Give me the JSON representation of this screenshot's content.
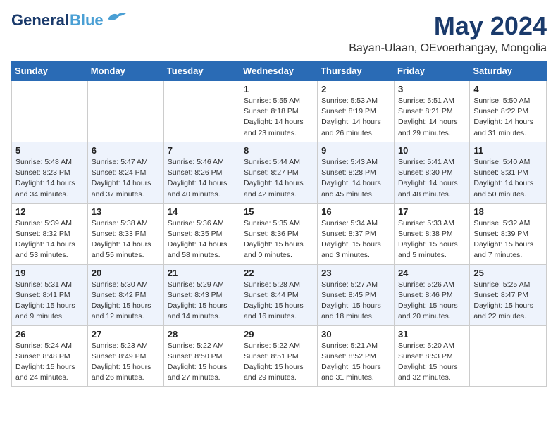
{
  "header": {
    "logo_general": "General",
    "logo_blue": "Blue",
    "main_title": "May 2024",
    "subtitle": "Bayan-Ulaan, OEvoerhangay, Mongolia"
  },
  "calendar": {
    "days_of_week": [
      "Sunday",
      "Monday",
      "Tuesday",
      "Wednesday",
      "Thursday",
      "Friday",
      "Saturday"
    ],
    "weeks": [
      {
        "days": [
          {
            "number": "",
            "info": ""
          },
          {
            "number": "",
            "info": ""
          },
          {
            "number": "",
            "info": ""
          },
          {
            "number": "1",
            "info": "Sunrise: 5:55 AM\nSunset: 8:18 PM\nDaylight: 14 hours\nand 23 minutes."
          },
          {
            "number": "2",
            "info": "Sunrise: 5:53 AM\nSunset: 8:19 PM\nDaylight: 14 hours\nand 26 minutes."
          },
          {
            "number": "3",
            "info": "Sunrise: 5:51 AM\nSunset: 8:21 PM\nDaylight: 14 hours\nand 29 minutes."
          },
          {
            "number": "4",
            "info": "Sunrise: 5:50 AM\nSunset: 8:22 PM\nDaylight: 14 hours\nand 31 minutes."
          }
        ]
      },
      {
        "days": [
          {
            "number": "5",
            "info": "Sunrise: 5:48 AM\nSunset: 8:23 PM\nDaylight: 14 hours\nand 34 minutes."
          },
          {
            "number": "6",
            "info": "Sunrise: 5:47 AM\nSunset: 8:24 PM\nDaylight: 14 hours\nand 37 minutes."
          },
          {
            "number": "7",
            "info": "Sunrise: 5:46 AM\nSunset: 8:26 PM\nDaylight: 14 hours\nand 40 minutes."
          },
          {
            "number": "8",
            "info": "Sunrise: 5:44 AM\nSunset: 8:27 PM\nDaylight: 14 hours\nand 42 minutes."
          },
          {
            "number": "9",
            "info": "Sunrise: 5:43 AM\nSunset: 8:28 PM\nDaylight: 14 hours\nand 45 minutes."
          },
          {
            "number": "10",
            "info": "Sunrise: 5:41 AM\nSunset: 8:30 PM\nDaylight: 14 hours\nand 48 minutes."
          },
          {
            "number": "11",
            "info": "Sunrise: 5:40 AM\nSunset: 8:31 PM\nDaylight: 14 hours\nand 50 minutes."
          }
        ]
      },
      {
        "days": [
          {
            "number": "12",
            "info": "Sunrise: 5:39 AM\nSunset: 8:32 PM\nDaylight: 14 hours\nand 53 minutes."
          },
          {
            "number": "13",
            "info": "Sunrise: 5:38 AM\nSunset: 8:33 PM\nDaylight: 14 hours\nand 55 minutes."
          },
          {
            "number": "14",
            "info": "Sunrise: 5:36 AM\nSunset: 8:35 PM\nDaylight: 14 hours\nand 58 minutes."
          },
          {
            "number": "15",
            "info": "Sunrise: 5:35 AM\nSunset: 8:36 PM\nDaylight: 15 hours\nand 0 minutes."
          },
          {
            "number": "16",
            "info": "Sunrise: 5:34 AM\nSunset: 8:37 PM\nDaylight: 15 hours\nand 3 minutes."
          },
          {
            "number": "17",
            "info": "Sunrise: 5:33 AM\nSunset: 8:38 PM\nDaylight: 15 hours\nand 5 minutes."
          },
          {
            "number": "18",
            "info": "Sunrise: 5:32 AM\nSunset: 8:39 PM\nDaylight: 15 hours\nand 7 minutes."
          }
        ]
      },
      {
        "days": [
          {
            "number": "19",
            "info": "Sunrise: 5:31 AM\nSunset: 8:41 PM\nDaylight: 15 hours\nand 9 minutes."
          },
          {
            "number": "20",
            "info": "Sunrise: 5:30 AM\nSunset: 8:42 PM\nDaylight: 15 hours\nand 12 minutes."
          },
          {
            "number": "21",
            "info": "Sunrise: 5:29 AM\nSunset: 8:43 PM\nDaylight: 15 hours\nand 14 minutes."
          },
          {
            "number": "22",
            "info": "Sunrise: 5:28 AM\nSunset: 8:44 PM\nDaylight: 15 hours\nand 16 minutes."
          },
          {
            "number": "23",
            "info": "Sunrise: 5:27 AM\nSunset: 8:45 PM\nDaylight: 15 hours\nand 18 minutes."
          },
          {
            "number": "24",
            "info": "Sunrise: 5:26 AM\nSunset: 8:46 PM\nDaylight: 15 hours\nand 20 minutes."
          },
          {
            "number": "25",
            "info": "Sunrise: 5:25 AM\nSunset: 8:47 PM\nDaylight: 15 hours\nand 22 minutes."
          }
        ]
      },
      {
        "days": [
          {
            "number": "26",
            "info": "Sunrise: 5:24 AM\nSunset: 8:48 PM\nDaylight: 15 hours\nand 24 minutes."
          },
          {
            "number": "27",
            "info": "Sunrise: 5:23 AM\nSunset: 8:49 PM\nDaylight: 15 hours\nand 26 minutes."
          },
          {
            "number": "28",
            "info": "Sunrise: 5:22 AM\nSunset: 8:50 PM\nDaylight: 15 hours\nand 27 minutes."
          },
          {
            "number": "29",
            "info": "Sunrise: 5:22 AM\nSunset: 8:51 PM\nDaylight: 15 hours\nand 29 minutes."
          },
          {
            "number": "30",
            "info": "Sunrise: 5:21 AM\nSunset: 8:52 PM\nDaylight: 15 hours\nand 31 minutes."
          },
          {
            "number": "31",
            "info": "Sunrise: 5:20 AM\nSunset: 8:53 PM\nDaylight: 15 hours\nand 32 minutes."
          },
          {
            "number": "",
            "info": ""
          }
        ]
      }
    ]
  }
}
